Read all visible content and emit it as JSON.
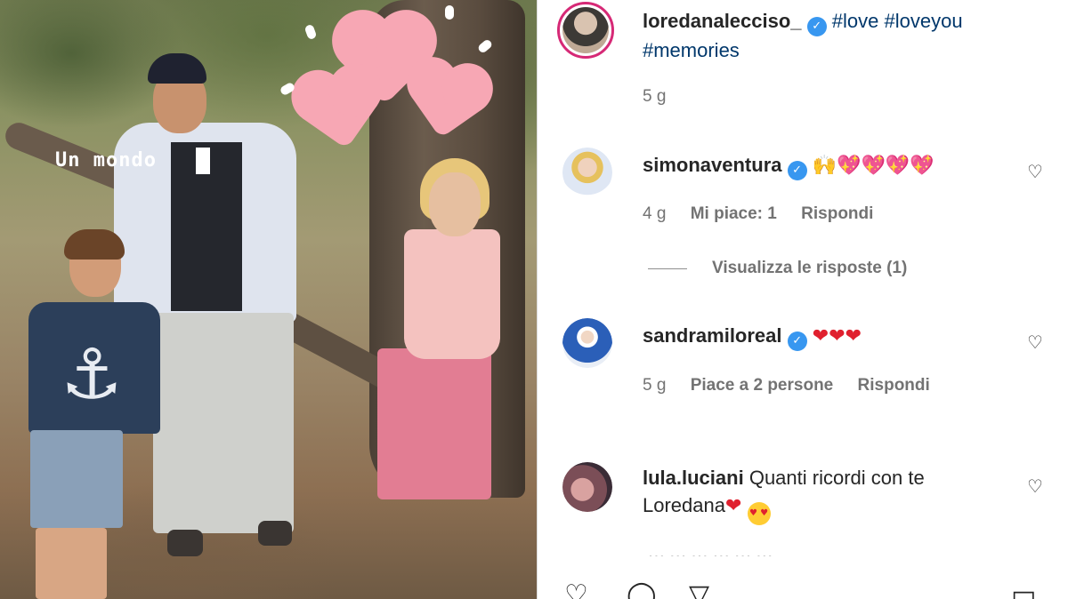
{
  "story": {
    "overlay_text": "Un mondo"
  },
  "post": {
    "author": "loredanalecciso_",
    "caption_hashtags": [
      "#love",
      "#loveyou",
      "#memories"
    ],
    "time": "5 g"
  },
  "comments": [
    {
      "username": "simonaventura",
      "verified": true,
      "text": "",
      "emojis": "🙌💖💖💖💖",
      "time": "4 g",
      "likes": "Mi piace: 1",
      "reply_label": "Rispondi",
      "view_replies": "Visualizza le risposte (1)"
    },
    {
      "username": "sandramiloreal",
      "verified": true,
      "text": "",
      "emojis": "❤❤❤",
      "time": "5 g",
      "likes": "Piace a 2 persone",
      "reply_label": "Rispondi"
    },
    {
      "username": "lula.luciani",
      "verified": false,
      "text": "Quanti ricordi con te",
      "text_line2": "Loredana",
      "emojis": "❤"
    }
  ],
  "icons": {
    "like": "heart-outline-icon",
    "comment": "comment-bubble-icon",
    "share": "paper-plane-icon",
    "save": "bookmark-icon",
    "verified": "verified-badge-icon"
  },
  "colors": {
    "verified": "#3897f0",
    "hashtag": "#00376b",
    "meta": "#737373",
    "story_ring": "#d62976",
    "sticker_heart": "#f7a7b4"
  }
}
